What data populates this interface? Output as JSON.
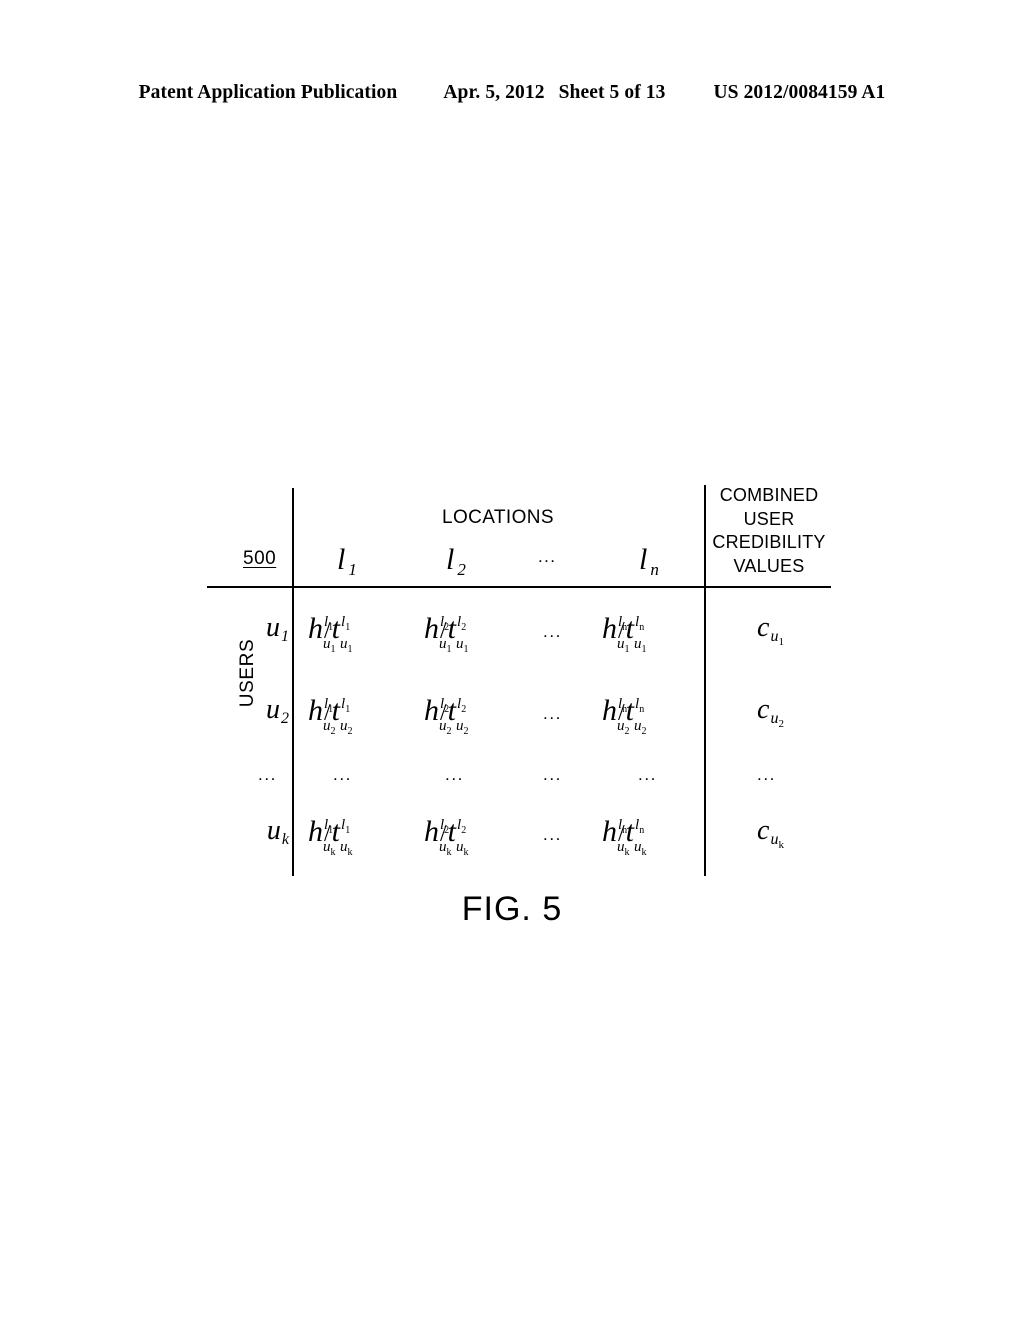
{
  "page_header": {
    "publication": "Patent Application Publication",
    "date": "Apr. 5, 2012",
    "sheet": "Sheet 5 of 13",
    "patent_number": "US 2012/0084159 A1"
  },
  "figure": {
    "caption": "FIG. 5",
    "reference_numeral": "500",
    "row_group_label": "USERS",
    "column_group_label": "LOCATIONS",
    "credibility_header_lines": [
      "COMBINED",
      "USER",
      "CREDIBILITY",
      "VALUES"
    ],
    "ellipsis": "...",
    "separator": "/"
  },
  "table": {
    "location_columns": [
      {
        "base": "l",
        "index": "1"
      },
      {
        "base": "l",
        "index": "2"
      },
      {
        "base": "l",
        "index": "n"
      }
    ],
    "rows": [
      {
        "user": {
          "base": "u",
          "index": "1"
        },
        "cells": [
          {
            "h_base": "h",
            "h_sup": "l",
            "h_sup_idx": "1",
            "h_sub": "u",
            "h_sub_idx": "1",
            "t_base": "t",
            "t_sup": "l",
            "t_sup_idx": "1",
            "t_sub": "u",
            "t_sub_idx": "1"
          },
          {
            "h_base": "h",
            "h_sup": "l",
            "h_sup_idx": "2",
            "h_sub": "u",
            "h_sub_idx": "1",
            "t_base": "t",
            "t_sup": "l",
            "t_sup_idx": "2",
            "t_sub": "u",
            "t_sub_idx": "1"
          },
          {
            "h_base": "h",
            "h_sup": "l",
            "h_sup_idx": "n",
            "h_sub": "u",
            "h_sub_idx": "1",
            "t_base": "t",
            "t_sup": "l",
            "t_sup_idx": "n",
            "t_sub": "u",
            "t_sub_idx": "1"
          }
        ],
        "credibility": {
          "base": "c",
          "sub": "u",
          "sub_idx": "1"
        }
      },
      {
        "user": {
          "base": "u",
          "index": "2"
        },
        "cells": [
          {
            "h_base": "h",
            "h_sup": "l",
            "h_sup_idx": "1",
            "h_sub": "u",
            "h_sub_idx": "2",
            "t_base": "t",
            "t_sup": "l",
            "t_sup_idx": "1",
            "t_sub": "u",
            "t_sub_idx": "2"
          },
          {
            "h_base": "h",
            "h_sup": "l",
            "h_sup_idx": "2",
            "h_sub": "u",
            "h_sub_idx": "2",
            "t_base": "t",
            "t_sup": "l",
            "t_sup_idx": "2",
            "t_sub": "u",
            "t_sub_idx": "2"
          },
          {
            "h_base": "h",
            "h_sup": "l",
            "h_sup_idx": "n",
            "h_sub": "u",
            "h_sub_idx": "2",
            "t_base": "t",
            "t_sup": "l",
            "t_sup_idx": "n",
            "t_sub": "u",
            "t_sub_idx": "2"
          }
        ],
        "credibility": {
          "base": "c",
          "sub": "u",
          "sub_idx": "2"
        }
      },
      {
        "user": {
          "base": "...",
          "index": ""
        },
        "cells": [],
        "credibility": {
          "base": "...",
          "sub": "",
          "sub_idx": ""
        }
      },
      {
        "user": {
          "base": "u",
          "index": "k"
        },
        "cells": [
          {
            "h_base": "h",
            "h_sup": "l",
            "h_sup_idx": "1",
            "h_sub": "u",
            "h_sub_idx": "k",
            "t_base": "t",
            "t_sup": "l",
            "t_sup_idx": "1",
            "t_sub": "u",
            "t_sub_idx": "k"
          },
          {
            "h_base": "h",
            "h_sup": "l",
            "h_sup_idx": "2",
            "h_sub": "u",
            "h_sub_idx": "k",
            "t_base": "t",
            "t_sup": "l",
            "t_sup_idx": "2",
            "t_sub": "u",
            "t_sub_idx": "k"
          },
          {
            "h_base": "h",
            "h_sup": "l",
            "h_sup_idx": "n",
            "h_sub": "u",
            "h_sub_idx": "k",
            "t_base": "t",
            "t_sup": "l",
            "t_sup_idx": "n",
            "t_sub": "u",
            "t_sub_idx": "k"
          }
        ],
        "credibility": {
          "base": "c",
          "sub": "u",
          "sub_idx": "k"
        }
      }
    ]
  },
  "colors": {
    "ink": "#000000",
    "paper": "#ffffff"
  }
}
